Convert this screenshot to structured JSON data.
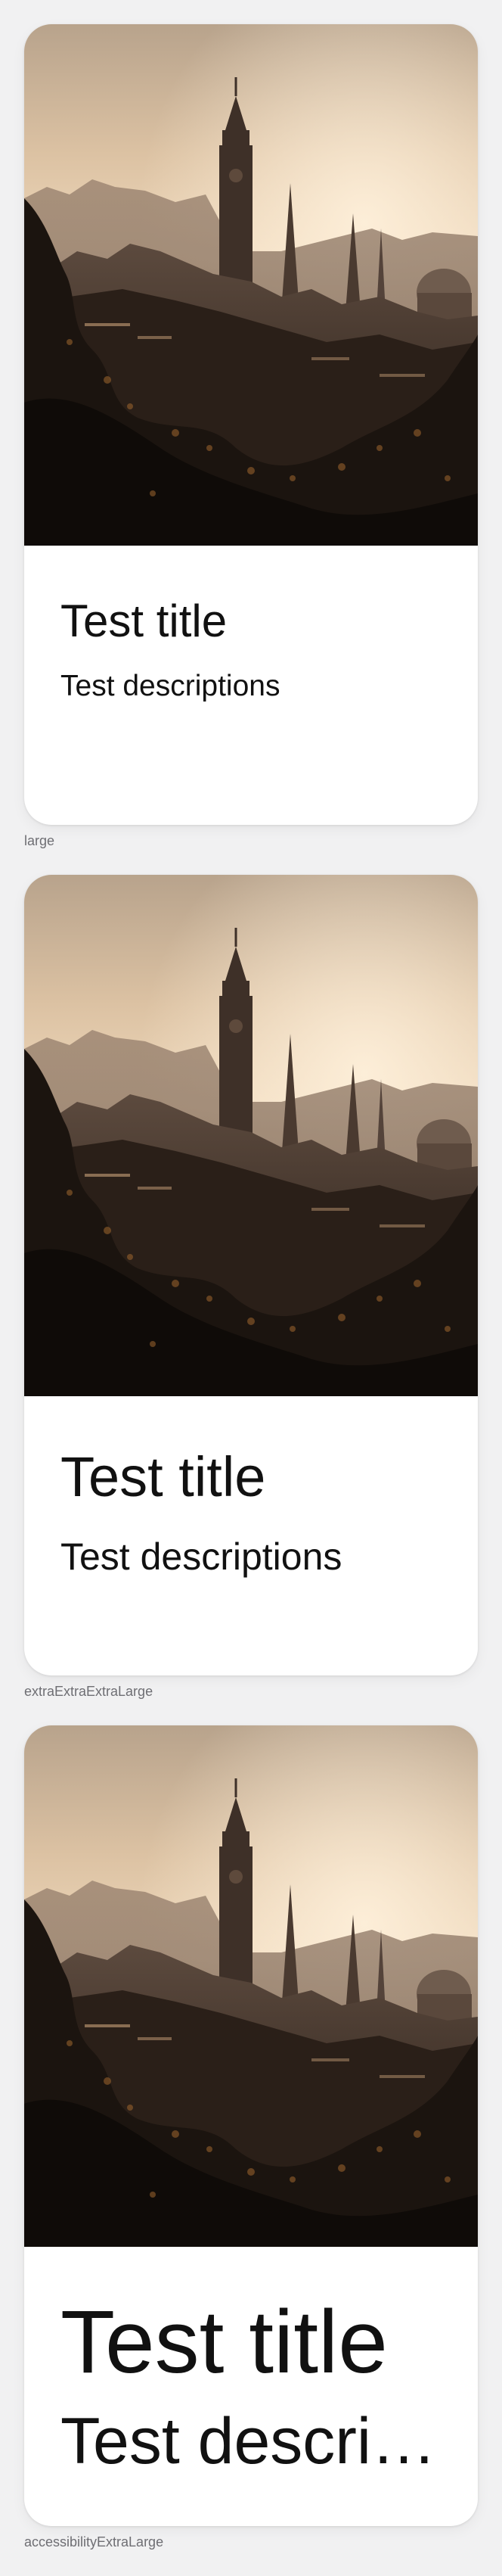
{
  "previews": [
    {
      "size_label": "large",
      "title": "Test title",
      "description": "Test descriptions"
    },
    {
      "size_label": "extraExtraExtraLarge",
      "title": "Test title",
      "description": "Test descriptions"
    },
    {
      "size_label": "accessibilityExtraLarge",
      "title": "Test title",
      "description": "Test descriptions"
    }
  ],
  "colors": {
    "background": "#f1f1f2",
    "card": "#ffffff",
    "text": "#111111",
    "caption": "#6e6e73"
  }
}
